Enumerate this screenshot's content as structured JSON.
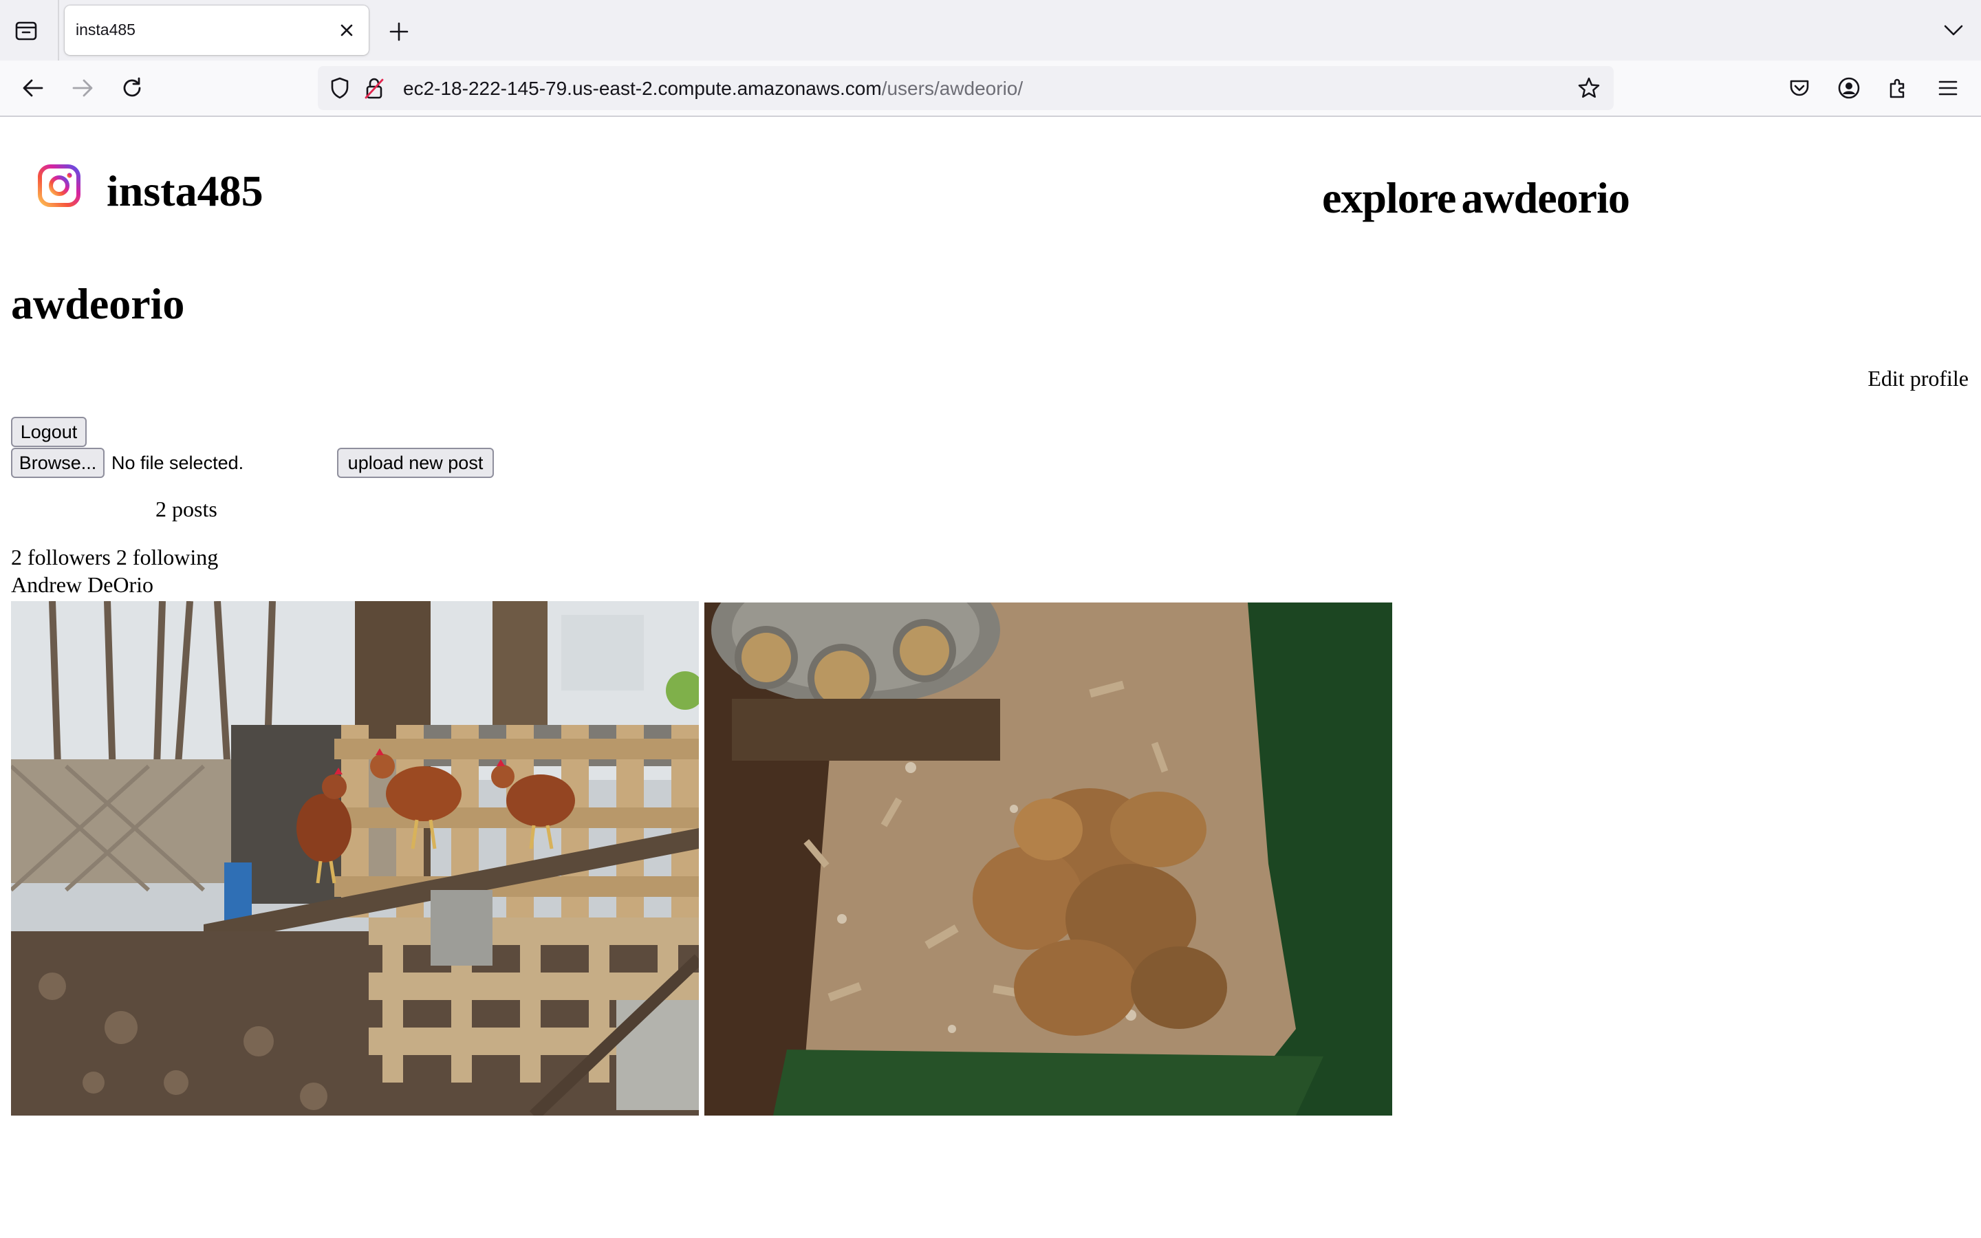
{
  "browser": {
    "tab_title": "insta485",
    "url_host": "ec2-18-222-145-79.us-east-2.compute.amazonaws.com",
    "url_path": "/users/awdeorio/"
  },
  "header": {
    "site_title": "insta485",
    "nav_explore": "explore",
    "nav_user": "awdeorio"
  },
  "profile": {
    "username": "awdeorio",
    "edit_profile_label": "Edit profile",
    "logout_label": "Logout",
    "browse_label": "Browse...",
    "file_status": "No file selected.",
    "upload_label": "upload new post",
    "posts_count": "2 posts",
    "followers": "2 followers",
    "following": "2 following",
    "full_name": "Andrew DeOrio"
  },
  "posts": [
    {
      "id": "post-1"
    },
    {
      "id": "post-2"
    }
  ]
}
